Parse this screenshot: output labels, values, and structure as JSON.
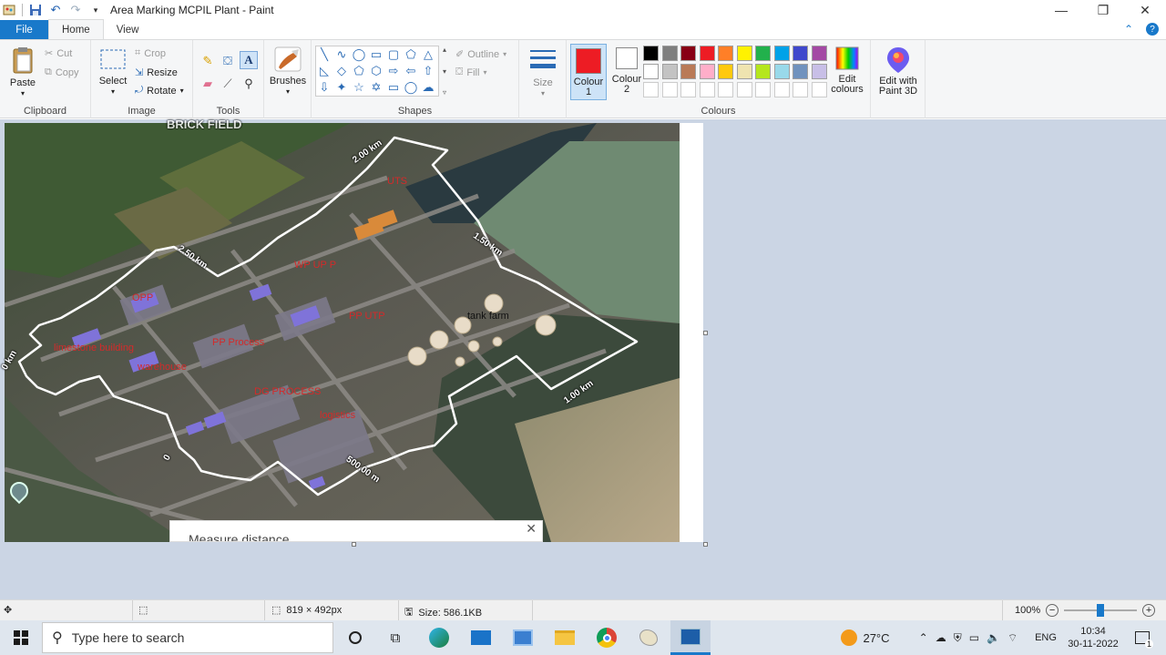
{
  "window": {
    "title": "Area Marking MCPIL Plant - Paint",
    "controls": {
      "minimize": "—",
      "restore": "❐",
      "close": "✕"
    }
  },
  "tabs": {
    "file": "File",
    "home": "Home",
    "view": "View"
  },
  "ribbon": {
    "clipboard": {
      "label": "Clipboard",
      "paste": "Paste",
      "cut": "Cut",
      "copy": "Copy"
    },
    "image": {
      "label": "Image",
      "select": "Select",
      "crop": "Crop",
      "resize": "Resize",
      "rotate": "Rotate"
    },
    "tools": {
      "label": "Tools"
    },
    "brushes": {
      "label": "Brushes"
    },
    "shapes": {
      "label": "Shapes",
      "outline": "Outline",
      "fill": "Fill"
    },
    "size": {
      "label": "Size"
    },
    "colours": {
      "label": "Colours",
      "colour1": "Colour\n1",
      "colour1_line1": "Colour",
      "colour1_line2": "1",
      "colour2_line1": "Colour",
      "colour2_line2": "2",
      "colour1_value": "#ed1c24",
      "colour2_value": "#ffffff",
      "edit_line1": "Edit",
      "edit_line2": "colours",
      "paint3d_line1": "Edit with",
      "paint3d_line2": "Paint 3D",
      "palette_row1": [
        "#000000",
        "#7f7f7f",
        "#880015",
        "#ed1c24",
        "#ff7f27",
        "#fff200",
        "#22b14c",
        "#00a2e8",
        "#3f48cc",
        "#a349a4"
      ],
      "palette_row2": [
        "#ffffff",
        "#c3c3c3",
        "#b97a57",
        "#ffaec9",
        "#ffc90e",
        "#efe4b0",
        "#b5e61d",
        "#99d9ea",
        "#7092be",
        "#c8bfe7"
      ]
    }
  },
  "map": {
    "labels": {
      "top_partial": "BRICK FIELD",
      "utility": "UTS",
      "wp_plant": "WP UP P",
      "opp": "OPP",
      "pp_plant": "PP UTP",
      "tank_farm": "tank farm",
      "limestone": "limestone building",
      "warehouse": "warehouse",
      "pp_process": "PP Process",
      "dg_process": "DG PROCESS",
      "logistics": "logistics"
    },
    "distances": {
      "d1": "2.00 km",
      "d2": "1.50 km",
      "d3": "2.50 km",
      "d4": "1.00 km",
      "d5": "500.00 m",
      "d6": "0 km",
      "d7": "0"
    },
    "measure_dialog": {
      "title": "Measure distance",
      "close": "✕"
    }
  },
  "status": {
    "dimensions": "819 × 492px",
    "size": "Size: 586.1KB",
    "zoom": "100%"
  },
  "taskbar": {
    "search_placeholder": "Type here to search",
    "weather": "27°C",
    "language": "ENG",
    "time": "10:34",
    "date": "30-11-2022",
    "notif_count": "1"
  }
}
